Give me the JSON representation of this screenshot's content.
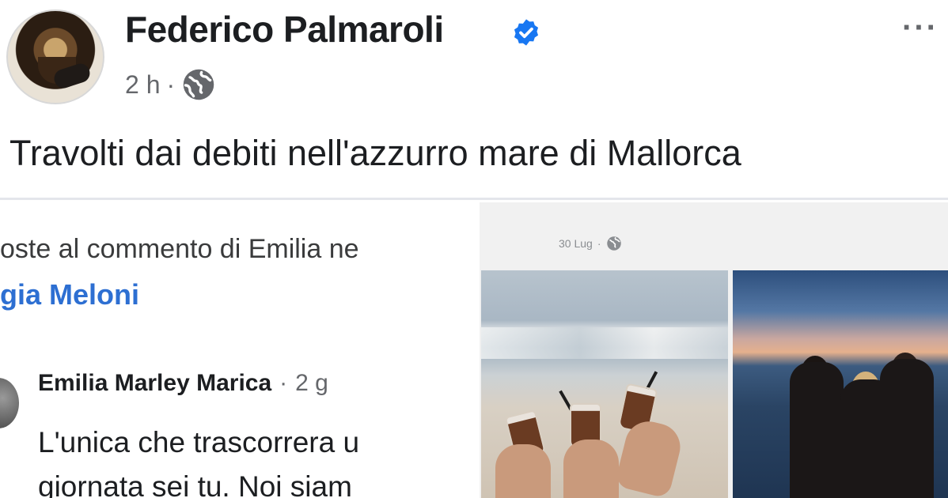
{
  "post": {
    "author": "Federico Palmaroli",
    "verified_icon": "verified-badge-icon",
    "time": "2 h",
    "separator": "·",
    "audience_icon": "globe-icon",
    "more_label": "···",
    "caption": "Travolti dai debiti nell'azzurro mare di Mallorca"
  },
  "embedded_comment": {
    "reply_note": "oste al commento di Emilia ne",
    "profile_link": "gia Meloni",
    "commenter_name": "Emilia Marley Marica",
    "commenter_age_separator": "·",
    "commenter_age": "2 g",
    "body_lines": [
      "L'unica che trascorrera u",
      "giornata sei tu. Noi siam"
    ]
  },
  "embedded_photos": {
    "date": "30 Lug",
    "separator": "·",
    "audience_icon": "globe-icon"
  },
  "colors": {
    "link_blue": "#2d6fd2",
    "verified_blue": "#1877f2",
    "secondary_text": "#65676b"
  }
}
